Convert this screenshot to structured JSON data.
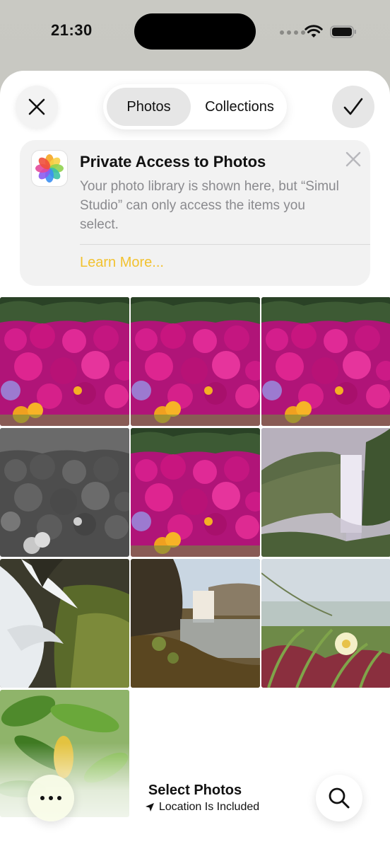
{
  "status_bar": {
    "time": "21:30"
  },
  "header": {
    "tabs": [
      {
        "label": "Photos",
        "selected": true
      },
      {
        "label": "Collections",
        "selected": false
      }
    ]
  },
  "banner": {
    "title": "Private Access to Photos",
    "body": "Your photo library is shown here, but “Simul Studio” can only access the items you select.",
    "link": "Learn More...",
    "link_color": "#f2c230"
  },
  "grid": {
    "photos": [
      {
        "subject": "pink flowers"
      },
      {
        "subject": "pink flowers"
      },
      {
        "subject": "pink flowers"
      },
      {
        "subject": "flowers grayscale"
      },
      {
        "subject": "pink flowers"
      },
      {
        "subject": "waterfall cliff"
      },
      {
        "subject": "waterfall rocks"
      },
      {
        "subject": "waterfall lake"
      },
      {
        "subject": "ice plant flower"
      },
      {
        "subject": "green leaves"
      }
    ]
  },
  "footer": {
    "title": "Select Photos",
    "subtitle": "Location Is Included"
  },
  "icons": {
    "close": "close-icon",
    "done": "checkmark-icon",
    "more": "ellipsis-icon",
    "search": "search-icon",
    "location": "location-arrow-icon"
  }
}
